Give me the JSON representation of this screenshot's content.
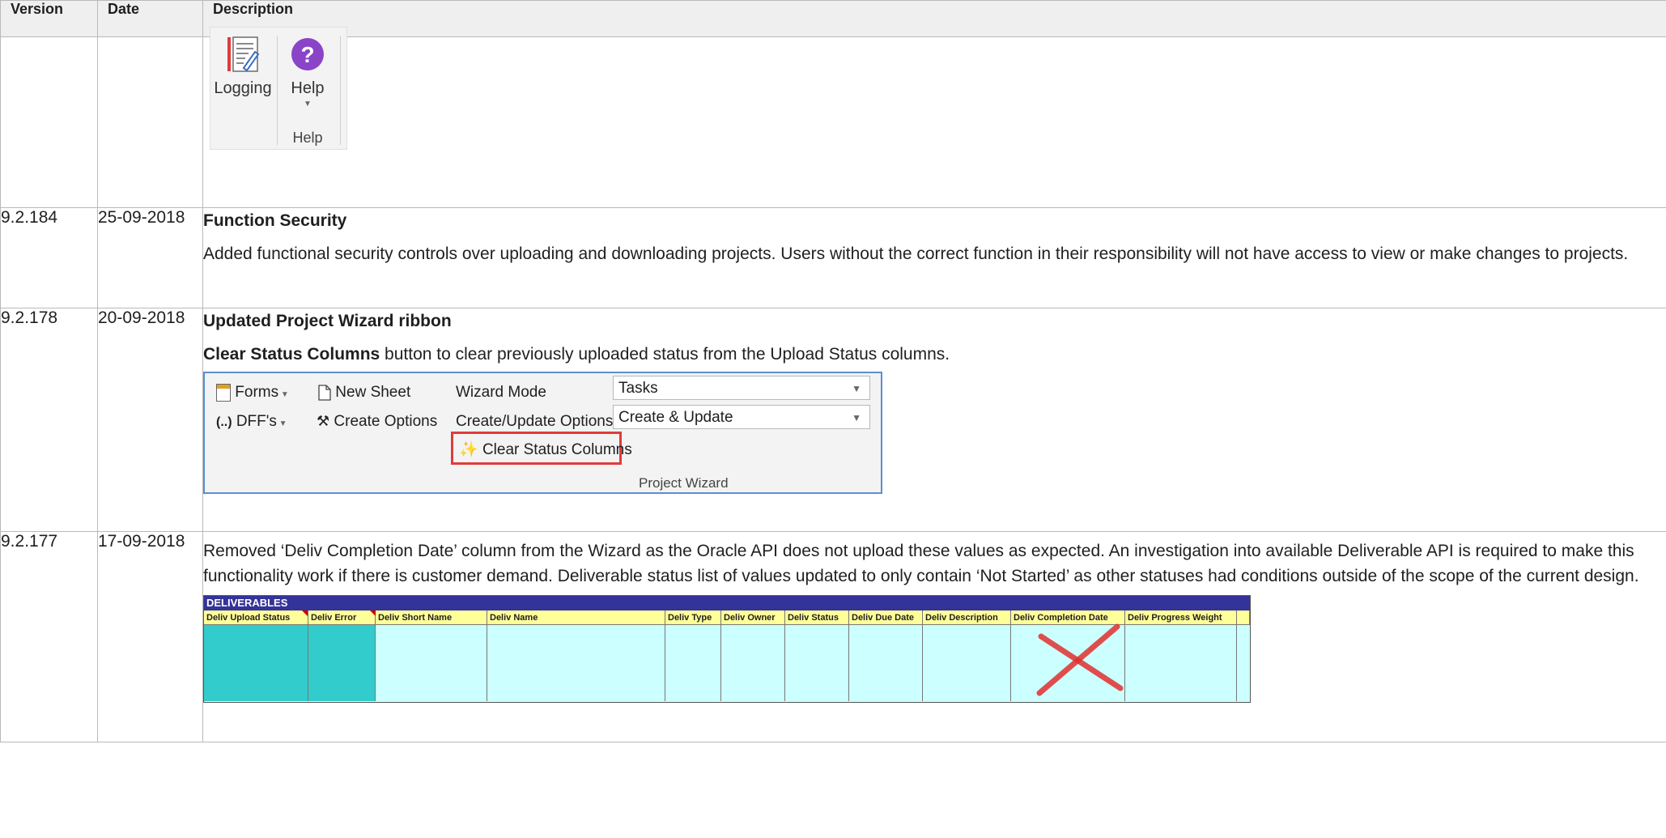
{
  "header": {
    "version": "Version",
    "date": "Date",
    "description": "Description"
  },
  "help_ribbon": {
    "logging_label": "Logging",
    "help_label": "Help",
    "group_label": "Help"
  },
  "rows": [
    {
      "version": "9.2.184",
      "date": "25-09-2018",
      "title": "Function Security",
      "body": "Added functional security controls over uploading and downloading projects.  Users without the correct function in their responsibility will not have access to view or make changes to projects."
    },
    {
      "version": "9.2.178",
      "date": "20-09-2018",
      "title": "Updated Project Wizard ribbon",
      "body_bold": "Clear Status Columns",
      "body_rest": " button to clear previously uploaded status from the Upload Status columns."
    },
    {
      "version": "9.2.177",
      "date": "17-09-2018",
      "body": "Removed ‘Deliv Completion Date’ column from the Wizard as the Oracle API does not upload these values as expected.  An investigation into available Deliverable API is required to make this functionality work if there is customer demand.  Deliverable status list of values updated to only contain ‘Not Started’ as other statuses had conditions outside of the scope of the current design."
    }
  ],
  "wizard": {
    "forms": "Forms",
    "dffs": "DFF's",
    "dff_icon_text": "(..)",
    "new_sheet": "New Sheet",
    "create_options": "Create Options",
    "wizard_mode_label": "Wizard Mode",
    "wizard_mode_value": "Tasks",
    "cu_label": "Create/Update Options",
    "cu_value": "Create & Update",
    "clear_status": "Clear Status Columns",
    "group_label": "Project Wizard"
  },
  "deliverables": {
    "title": "DELIVERABLES",
    "columns": [
      "Deliv Upload Status",
      "Deliv Error",
      "Deliv Short Name",
      "Deliv Name",
      "Deliv Type",
      "Deliv Owner",
      "Deliv Status",
      "Deliv Due Date",
      "Deliv Description",
      "Deliv Completion Date",
      "Deliv Progress Weight"
    ]
  },
  "colors": {
    "accent_red": "#e03b3b",
    "deliv_header": "#333399",
    "deliv_colhdr": "#ffff99",
    "deliv_teal": "#33cccc",
    "deliv_light": "#ccffff"
  }
}
